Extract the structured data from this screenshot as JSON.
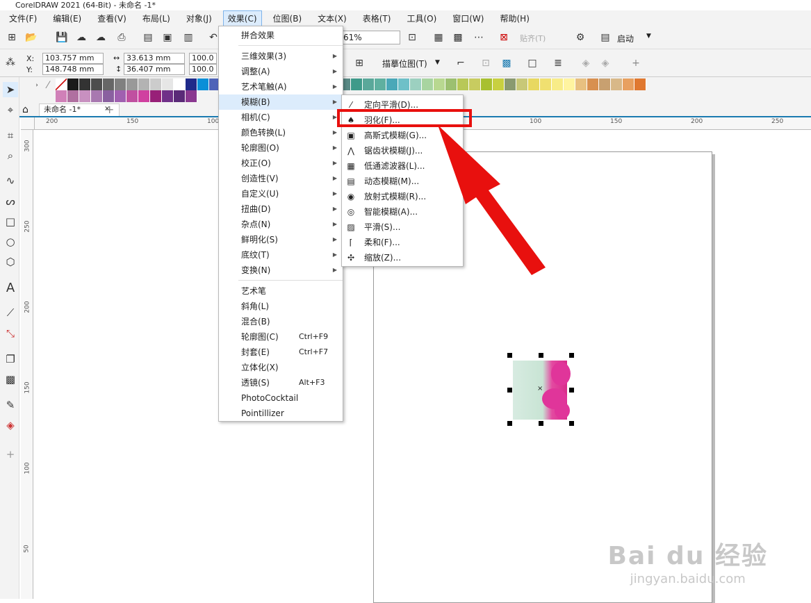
{
  "window": {
    "title": "CorelDRAW 2021 (64-Bit) - 未命名 -1*"
  },
  "menubar": [
    "文件(F)",
    "编辑(E)",
    "查看(V)",
    "布局(L)",
    "对象(J)",
    "效果(C)",
    "位图(B)",
    "文本(X)",
    "表格(T)",
    "工具(O)",
    "窗口(W)",
    "帮助(H)"
  ],
  "toolbar": {
    "zoom": "61%",
    "paste_label": "贴齐(T)",
    "launch_label": "启动",
    "trace_label": "描摹位图(T)"
  },
  "property_bar": {
    "x_label": "X:",
    "x_value": "103.757 mm",
    "y_label": "Y:",
    "y_value": "148.748 mm",
    "w_value": "33.613 mm",
    "h_value": "36.407 mm",
    "sx_value": "100.0",
    "sy_value": "100.0"
  },
  "doc_tab": {
    "title": "未命名 -1*"
  },
  "ruler": {
    "h_ticks": [
      "200",
      "150",
      "100",
      "100",
      "150",
      "200",
      "250"
    ],
    "v_ticks": [
      "300",
      "250",
      "200",
      "150",
      "100",
      "50"
    ]
  },
  "effects_menu": {
    "items": [
      {
        "label": "拼合效果"
      },
      {
        "label": "三维效果(3)",
        "arrow": true
      },
      {
        "label": "调整(A)",
        "arrow": true
      },
      {
        "label": "艺术笔触(A)",
        "arrow": true
      },
      {
        "label": "模糊(B)",
        "arrow": true,
        "hl": true
      },
      {
        "label": "相机(C)",
        "arrow": true
      },
      {
        "label": "颜色转换(L)",
        "arrow": true
      },
      {
        "label": "轮廓图(O)",
        "arrow": true
      },
      {
        "label": "校正(O)",
        "arrow": true
      },
      {
        "label": "创造性(V)",
        "arrow": true
      },
      {
        "label": "自定义(U)",
        "arrow": true
      },
      {
        "label": "扭曲(D)",
        "arrow": true
      },
      {
        "label": "杂点(N)",
        "arrow": true
      },
      {
        "label": "鲜明化(S)",
        "arrow": true
      },
      {
        "label": "底纹(T)",
        "arrow": true
      },
      {
        "label": "变换(N)",
        "arrow": true
      },
      {
        "label": "艺术笔"
      },
      {
        "label": "斜角(L)"
      },
      {
        "label": "混合(B)"
      },
      {
        "label": "轮廓图(C)",
        "shortcut": "Ctrl+F9"
      },
      {
        "label": "封套(E)",
        "shortcut": "Ctrl+F7"
      },
      {
        "label": "立体化(X)"
      },
      {
        "label": "透镜(S)",
        "shortcut": "Alt+F3"
      },
      {
        "label": "PhotoCocktail"
      },
      {
        "label": "Pointillizer"
      }
    ]
  },
  "blur_submenu": {
    "items": [
      {
        "label": "定向平滑(D)...",
        "icon": "directional-smooth-icon"
      },
      {
        "label": "羽化(F)...",
        "icon": "feather-icon"
      },
      {
        "label": "高斯式模糊(G)...",
        "icon": "gaussian-blur-icon"
      },
      {
        "label": "锯齿状模糊(J)...",
        "icon": "jaggy-despeckle-icon"
      },
      {
        "label": "低通滤波器(L)...",
        "icon": "low-pass-icon"
      },
      {
        "label": "动态模糊(M)...",
        "icon": "motion-blur-icon"
      },
      {
        "label": "放射式模糊(R)...",
        "icon": "radial-blur-icon"
      },
      {
        "label": "智能模糊(A)...",
        "icon": "smart-blur-icon"
      },
      {
        "label": "平滑(S)...",
        "icon": "smooth-icon"
      },
      {
        "label": "柔和(F)...",
        "icon": "soften-icon"
      },
      {
        "label": "缩放(Z)...",
        "icon": "zoom-blur-icon"
      }
    ]
  },
  "palette": {
    "row1": [
      "#ffffff",
      "#1a1a1a",
      "#333333",
      "#4d4d4d",
      "#666666",
      "#808080",
      "#999999",
      "#b3b3b3",
      "#cccccc",
      "#e6e6e6",
      "#ffffff",
      "#1f2a8a",
      "#0a8fd8",
      "#4e63b8",
      "#6a7cc8",
      "#8090d0",
      "#2f6fb8",
      "#0d9be8",
      "#52b8ea",
      "#7fc6ea",
      "#a8d6ee",
      "#3f6f8f",
      "#5a8aa0",
      "#4b5e6e",
      "#5a8a86",
      "#3f9a8a",
      "#5aa89a",
      "#5fb0a0",
      "#4aa8b8",
      "#6ec0c8",
      "#9cd0c0",
      "#a8d4a0",
      "#b8d890",
      "#9cc070",
      "#b8c858",
      "#c8cc60",
      "#a8c030",
      "#c8d040",
      "#8a9a70",
      "#c8c878",
      "#e8d860",
      "#f0e070",
      "#f8ec88",
      "#fff4a0",
      "#e8c080",
      "#d89050",
      "#c8a070",
      "#d8b888",
      "#e8a060",
      "#e07830"
    ],
    "row2": [
      "#d080b8",
      "#b070a0",
      "#c890c0",
      "#a878b0",
      "#8a60a0",
      "#a060b0",
      "#c050a0",
      "#d040a0",
      "#982078",
      "#703088",
      "#5a2a78",
      "#8a3890"
    ]
  },
  "watermark": {
    "brand": "Bai du 经验",
    "url": "jingyan.baidu.com"
  },
  "colors": {
    "accent": "#1a7ab0",
    "highlight": "#dcecfc",
    "red": "#e8100e"
  }
}
